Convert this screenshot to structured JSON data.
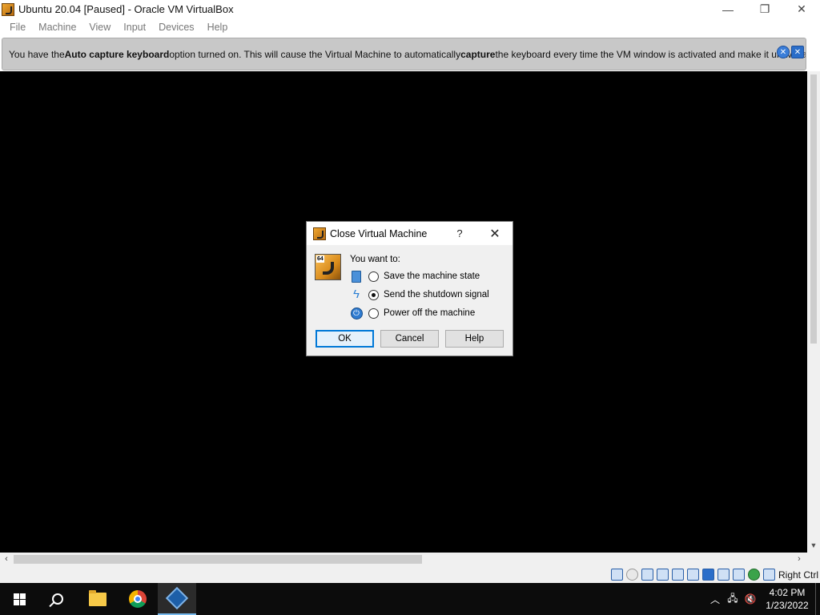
{
  "window": {
    "title": "Ubuntu 20.04 [Paused] - Oracle VM VirtualBox",
    "minimize_glyph": "—",
    "restore_glyph": "❐",
    "close_glyph": "✕"
  },
  "menu": {
    "items": [
      "File",
      "Machine",
      "View",
      "Input",
      "Devices",
      "Help"
    ]
  },
  "notice": {
    "text_before": "You have the ",
    "bold_1": "Auto capture keyboard",
    "text_middle": " option turned on. This will cause the Virtual Machine to automatically ",
    "bold_2": "capture",
    "text_after": " the keyboard every time the VM window is activated and make it unavailable to"
  },
  "dialog": {
    "title": "Close Virtual Machine",
    "help_glyph": "?",
    "close_glyph": "✕",
    "badge": "64",
    "prompt": "You want to:",
    "options": [
      {
        "label": "Save the machine state",
        "icon": "save-state-icon",
        "selected": false
      },
      {
        "label": "Send the shutdown signal",
        "icon": "acpi-shutdown-icon",
        "selected": true
      },
      {
        "label": "Power off the machine",
        "icon": "power-off-icon",
        "selected": false
      }
    ],
    "buttons": {
      "ok": "OK",
      "cancel": "Cancel",
      "help": "Help"
    }
  },
  "statusbar": {
    "host_key": "Right Ctrl"
  },
  "taskbar": {
    "time": "4:02 PM",
    "date": "1/23/2022"
  },
  "colors": {
    "vm_background": "#000000",
    "notice_background": "#c8c8c8",
    "accent": "#0078d7",
    "taskbar": "#0c0c0c"
  }
}
